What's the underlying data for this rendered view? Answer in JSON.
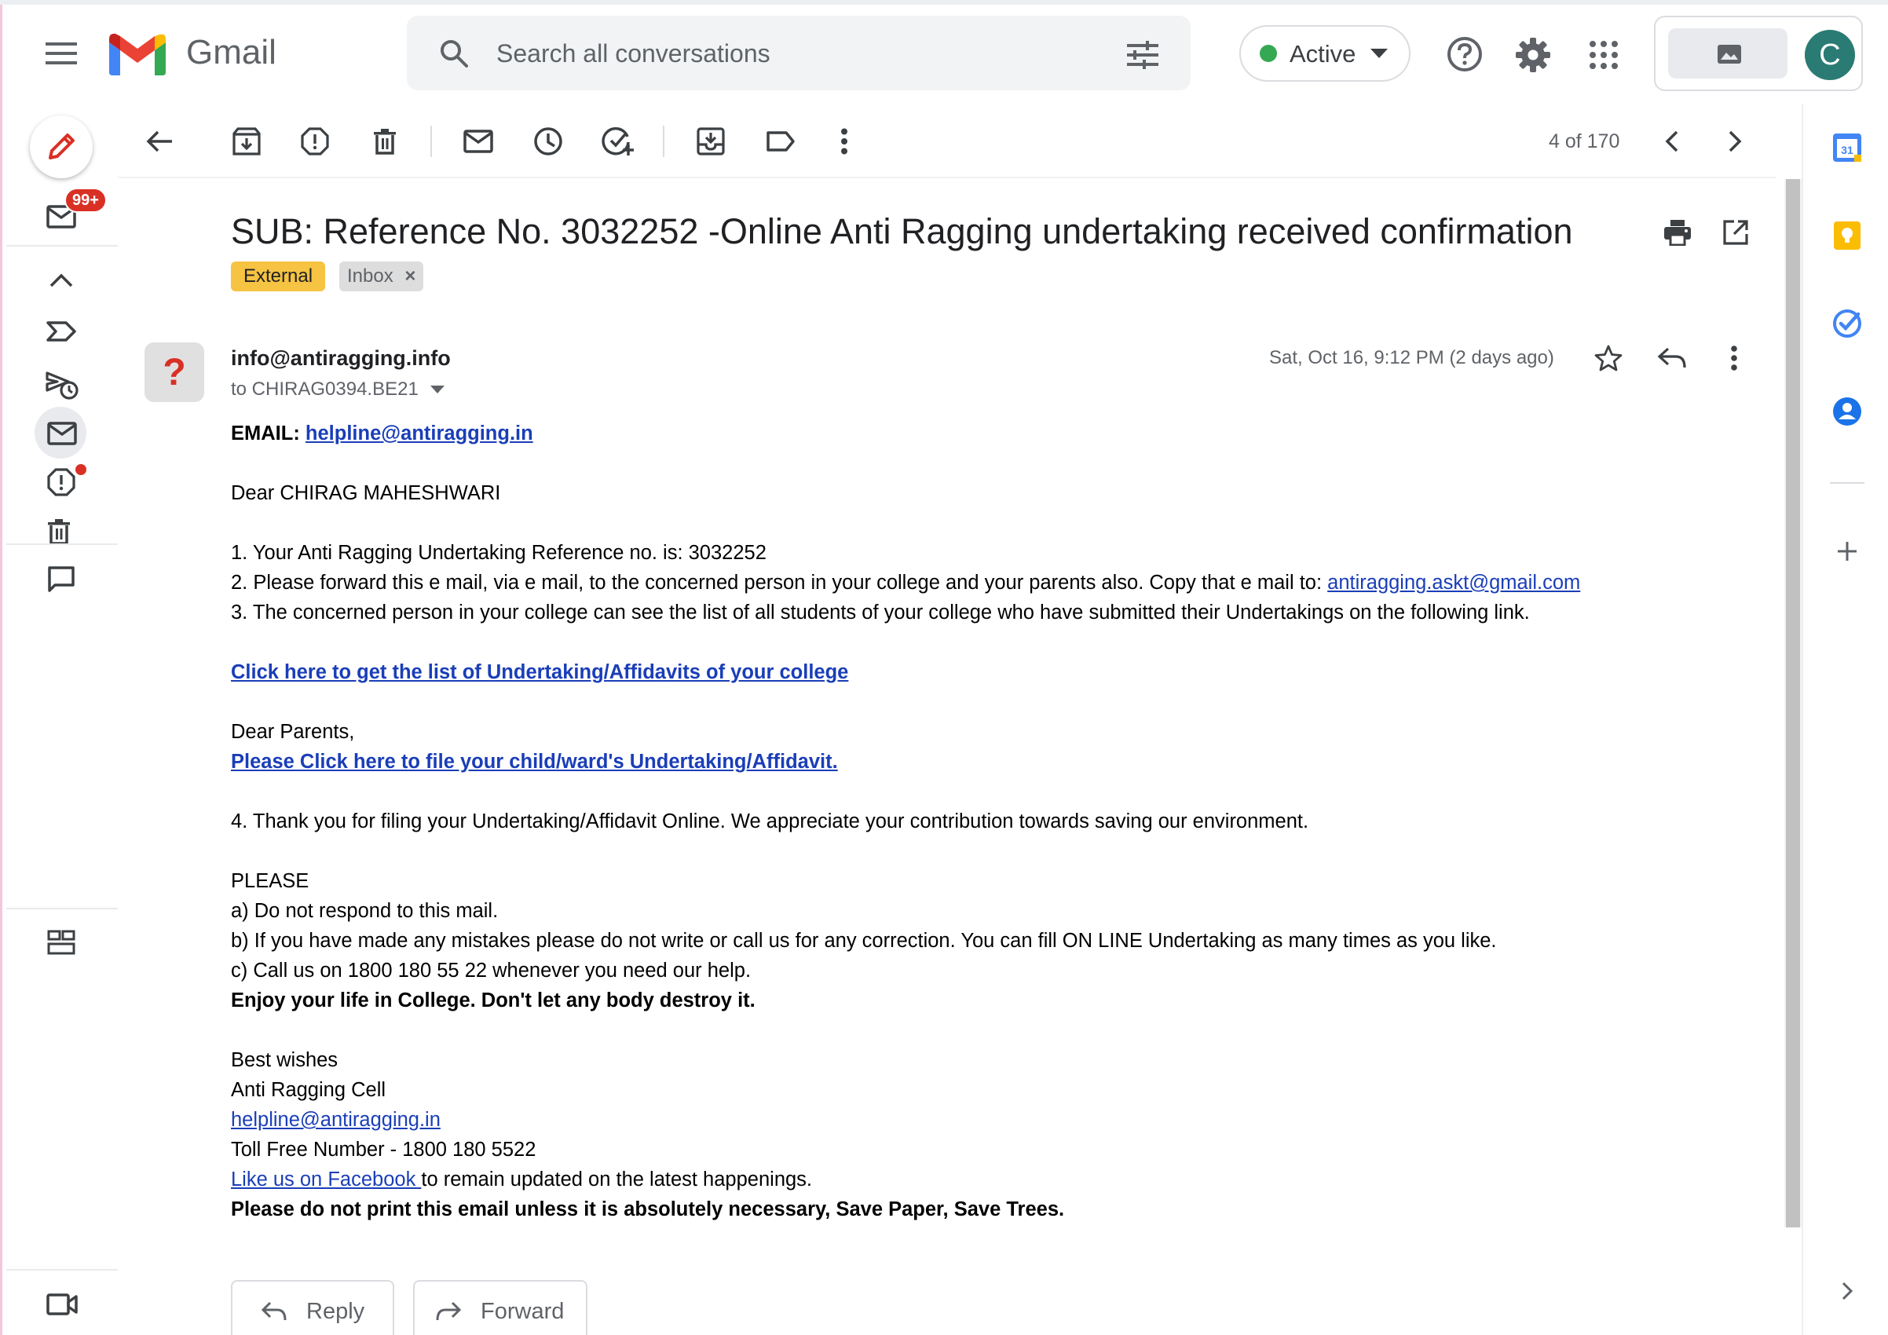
{
  "app": {
    "name": "Gmail",
    "brand_colors": {
      "red": "#ea4335",
      "blue": "#4285f4",
      "green": "#34a853",
      "yellow": "#fbbc04"
    }
  },
  "header": {
    "search_placeholder": "Search all conversations",
    "status_label": "Active",
    "avatar_letter": "C",
    "icons": [
      "menu-icon",
      "search-icon",
      "search-options-icon",
      "help-icon",
      "settings-icon",
      "apps-grid-icon"
    ]
  },
  "rail": {
    "unread_badge": "99+",
    "icons": [
      "compose-icon",
      "mail-icon",
      "collapse-icon",
      "important-icon",
      "scheduled-icon",
      "all-mail-icon",
      "spam-icon",
      "trash-icon",
      "chat-icon",
      "spaces-icon",
      "meet-icon"
    ]
  },
  "toolbar": {
    "pager": "4 of 170",
    "icons": [
      "back-icon",
      "archive-icon",
      "report-spam-icon",
      "delete-icon",
      "mark-unread-icon",
      "snooze-icon",
      "add-task-icon",
      "move-to-icon",
      "label-icon",
      "more-icon",
      "newer-icon",
      "older-icon"
    ]
  },
  "message": {
    "subject": "SUB: Reference No. 3032252 -Online Anti Ragging undertaking received confirmation",
    "labels": {
      "external": "External",
      "inbox": "Inbox",
      "inbox_remove": "×"
    },
    "sender_avatar": "?",
    "sender": "info@antiragging.info",
    "to": "to CHIRAG0394.BE21",
    "date": "Sat, Oct 16, 9:12 PM (2 days ago)"
  },
  "body": {
    "email_label": "EMAIL:",
    "email_link": "helpline@antiragging.in",
    "greeting": "Dear CHIRAG MAHESHWARI",
    "item1": "1. Your Anti Ragging Undertaking Reference no. is: 3032252",
    "item2_text": "2. Please forward this e mail, via e mail, to the concerned person in your college and your parents also. Copy that e mail to: ",
    "item2_link": "antiragging.askt@gmail.com",
    "item3": "3. The concerned person in your college can see the list of all students of your college who have submitted their Undertakings on the following link.",
    "college_link": "Click here to get the list of Undertaking/Affidavits of your college",
    "parents_greeting": "Dear Parents,",
    "parents_link": "Please Click here to file your child/ward's Undertaking/Affidavit.",
    "item4": "4. Thank you for filing your Undertaking/Affidavit Online. We appreciate your contribution towards saving our environment.",
    "please": "PLEASE",
    "a": "a) Do not respond to this mail.",
    "b_line": "b) If you have made any mistakes please do not write or call us for any correction. You can fill ON LINE Undertaking as many times as you like.",
    "c": "c) Call us on 1800 180 55 22 whenever you need our help.",
    "enjoy": "Enjoy your life in College. Don't let any body destroy it.",
    "wishes": "Best wishes",
    "cell": "Anti Ragging Cell",
    "helpline_link": "helpline@antiragging.in",
    "tollfree": "Toll Free Number - 1800 180 5522",
    "facebook_link": "Like us on Facebook ",
    "facebook_text": "to remain updated on the latest happenings.",
    "footer": "Please do not print this email unless it is absolutely necessary, Save Paper, Save Trees."
  },
  "actions": {
    "reply": "Reply",
    "forward": "Forward"
  },
  "side_panel": {
    "calendar_day": "31",
    "icons": [
      "calendar-icon",
      "keep-icon",
      "tasks-icon",
      "contacts-icon",
      "add-addon-icon",
      "expand-panel-icon"
    ]
  }
}
